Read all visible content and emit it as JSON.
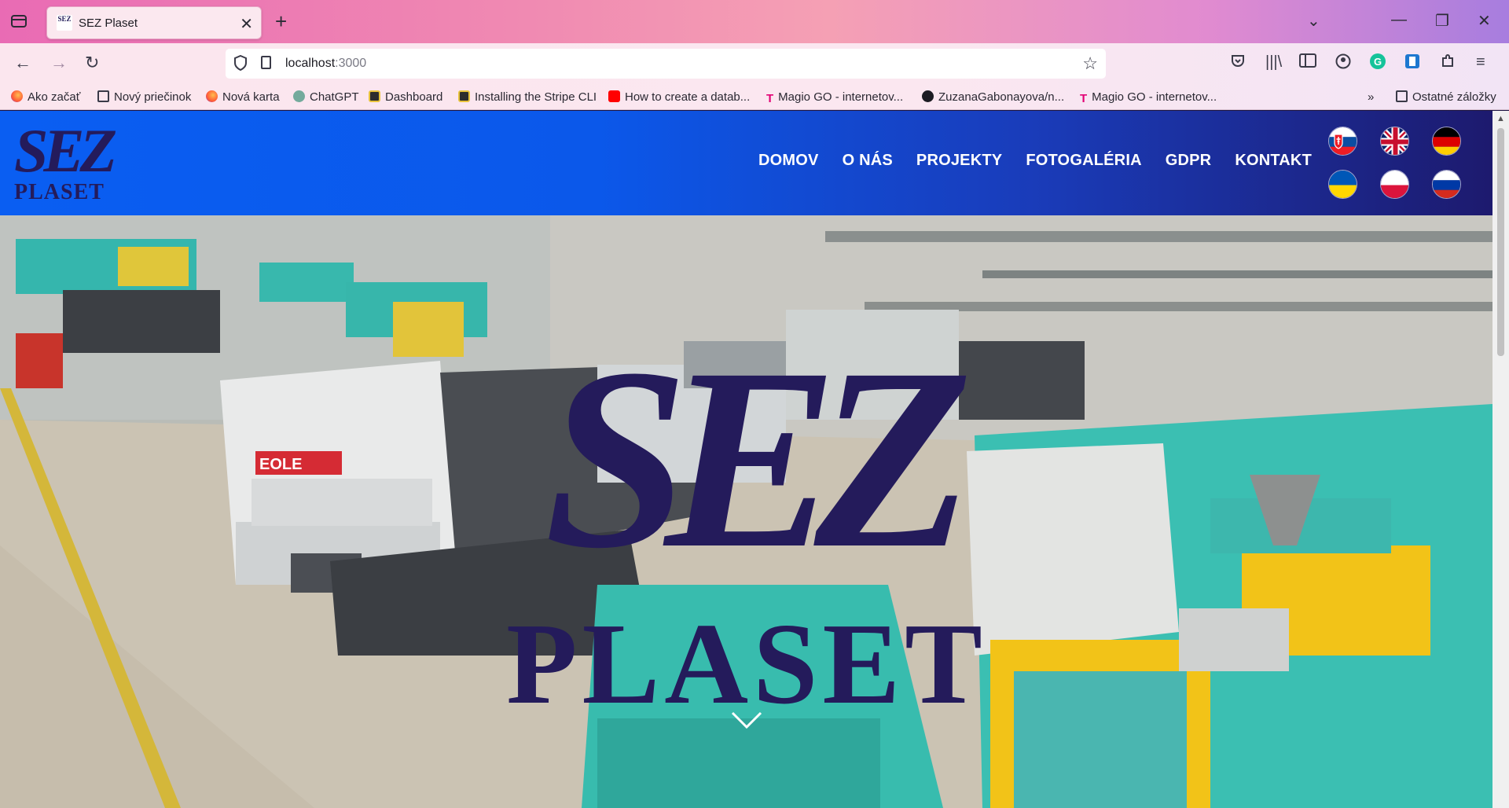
{
  "browser": {
    "tab_title": "SEZ Plaset",
    "tab_favicon_text": "SEZ",
    "url_host": "localhost",
    "url_port": ":3000",
    "bookmarks": [
      {
        "label": "Ako začať",
        "icon": "firefox-icon"
      },
      {
        "label": "Nový priečinok",
        "icon": "folder-icon"
      },
      {
        "label": "Nová karta",
        "icon": "firefox-icon"
      },
      {
        "label": "ChatGPT",
        "icon": "chatgpt-icon"
      },
      {
        "label": "Dashboard",
        "icon": "dashboard-icon"
      },
      {
        "label": "Installing the Stripe CLI",
        "icon": "stripe-icon"
      },
      {
        "label": "How to create a datab...",
        "icon": "youtube-icon"
      },
      {
        "label": "Magio GO - internetov...",
        "icon": "telekom-icon"
      },
      {
        "label": "ZuzanaGabonayova/n...",
        "icon": "github-icon"
      },
      {
        "label": "Magio GO - internetov...",
        "icon": "telekom-icon"
      }
    ],
    "other_bookmarks": "Ostatné záložky"
  },
  "site": {
    "logo_top": "SEZ",
    "logo_bottom": "PLASET",
    "menu": [
      "DOMOV",
      "O NÁS",
      "PROJEKTY",
      "FOTOGALÉRIA",
      "GDPR",
      "KONTAKT"
    ],
    "languages": [
      "slovak-flag",
      "uk-flag",
      "german-flag",
      "ukrainian-flag",
      "polish-flag",
      "russian-flag"
    ],
    "hero_logo_top": "SEZ",
    "hero_logo_bottom": "PLASET"
  },
  "colors": {
    "header_start": "#0a5ef2",
    "header_end": "#1d1a6e",
    "logo": "#241b5b",
    "machine_teal": "#3bbfb2",
    "machine_yellow": "#f2c318"
  }
}
